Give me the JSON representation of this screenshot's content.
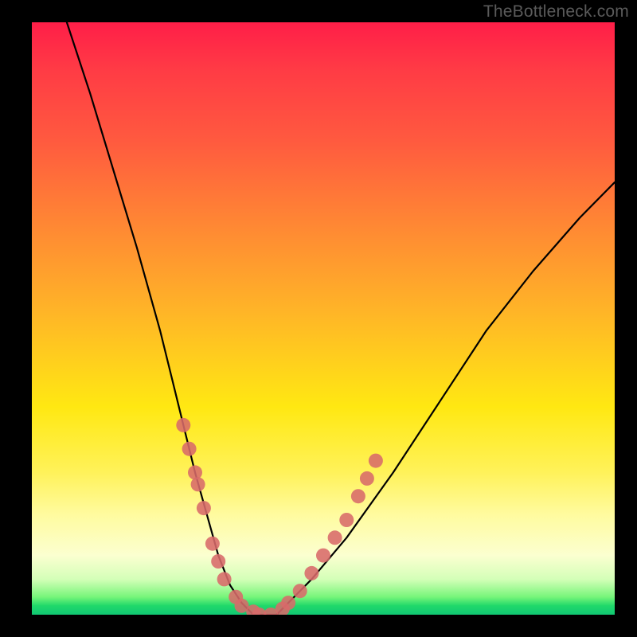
{
  "watermark": "TheBottleneck.com",
  "chart_data": {
    "type": "line",
    "title": "",
    "xlabel": "",
    "ylabel": "",
    "xlim": [
      0,
      100
    ],
    "ylim": [
      0,
      100
    ],
    "series": [
      {
        "name": "bottleneck-curve",
        "x": [
          6,
          10,
          14,
          18,
          22,
          24,
          26,
          28,
          30,
          32,
          34,
          36,
          38,
          40,
          42,
          44,
          48,
          54,
          62,
          70,
          78,
          86,
          94,
          100
        ],
        "y": [
          100,
          88,
          75,
          62,
          48,
          40,
          32,
          24,
          17,
          10,
          5,
          2,
          0,
          0,
          0,
          2,
          6,
          13,
          24,
          36,
          48,
          58,
          67,
          73
        ]
      }
    ],
    "markers": {
      "name": "highlight-dots",
      "color": "#d86a6a",
      "points": [
        {
          "x": 26,
          "y": 32
        },
        {
          "x": 27,
          "y": 28
        },
        {
          "x": 28,
          "y": 24
        },
        {
          "x": 28.5,
          "y": 22
        },
        {
          "x": 29.5,
          "y": 18
        },
        {
          "x": 31,
          "y": 12
        },
        {
          "x": 32,
          "y": 9
        },
        {
          "x": 33,
          "y": 6
        },
        {
          "x": 35,
          "y": 3
        },
        {
          "x": 36,
          "y": 1.5
        },
        {
          "x": 38,
          "y": 0.5
        },
        {
          "x": 39,
          "y": 0
        },
        {
          "x": 41,
          "y": 0
        },
        {
          "x": 43,
          "y": 1
        },
        {
          "x": 44,
          "y": 2
        },
        {
          "x": 46,
          "y": 4
        },
        {
          "x": 48,
          "y": 7
        },
        {
          "x": 50,
          "y": 10
        },
        {
          "x": 52,
          "y": 13
        },
        {
          "x": 54,
          "y": 16
        },
        {
          "x": 56,
          "y": 20
        },
        {
          "x": 57.5,
          "y": 23
        },
        {
          "x": 59,
          "y": 26
        }
      ]
    }
  }
}
